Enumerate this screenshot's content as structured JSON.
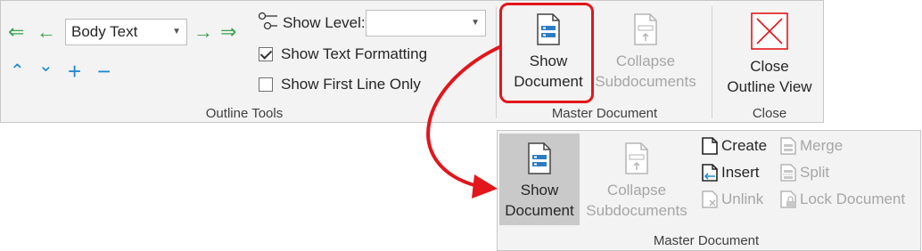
{
  "ribbon_top": {
    "outline_tools": {
      "group_label": "Outline Tools",
      "level_value": "Body Text",
      "show_level_label": "Show Level:",
      "show_level_value": "",
      "show_text_formatting": {
        "label": "Show Text Formatting",
        "checked": true
      },
      "show_first_line_only": {
        "label": "Show First Line Only",
        "checked": false
      }
    },
    "master_document": {
      "group_label": "Master Document",
      "show_document": [
        "Show",
        "Document"
      ],
      "collapse_subdocuments": [
        "Collapse",
        "Subdocuments"
      ]
    },
    "close": {
      "group_label": "Close",
      "close_outline_view": [
        "Close",
        "Outline View"
      ]
    }
  },
  "ribbon_expanded": {
    "group_label": "Master Document",
    "show_document": [
      "Show",
      "Document"
    ],
    "collapse_subdocuments": [
      "Collapse",
      "Subdocuments"
    ],
    "buttons": {
      "create": "Create",
      "insert": "Insert",
      "unlink": "Unlink",
      "merge": "Merge",
      "split": "Split",
      "lock_document": "Lock Document"
    }
  },
  "colors": {
    "highlight": "#e2161b",
    "arrow_green": "#3aa14a",
    "arrow_blue": "#1f8ad6",
    "disabled_text": "#a6a6a6",
    "close_icon": "#e2161b"
  }
}
